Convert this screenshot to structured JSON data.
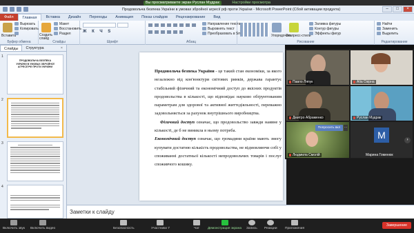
{
  "share_banner": {
    "text": "Вы просматриваете экран Руслан Мудрак",
    "options_label": "Настройки просмотра"
  },
  "ppt_title": "Продовольча безпека України в умовах збройної агресії рф проти України  -  Microsoft PowerPoint (Сбой активации продукта)",
  "menu_tabs": [
    "Файл",
    "Главная",
    "Вставка",
    "Дизайн",
    "Переходы",
    "Анимация",
    "Показ слайдов",
    "Рецензирование",
    "Вид"
  ],
  "ribbon": {
    "paste": "Вставить",
    "cut": "Вырезать",
    "copy": "Копировать",
    "format": "Формат по образцу",
    "clipboard_group": "Буфер обмена",
    "create_slide": "Создать слайд",
    "layout": "Макет",
    "reset": "Восстановить",
    "section": "Раздел",
    "slides_group": "Слайды",
    "font_group": "Шрифт",
    "paragraph_group": "Абзац",
    "text_direction": "Направление текста",
    "align_text": "Выровнять текст",
    "smartart": "Преобразовать в SmartArt",
    "drawing_group": "Рисование",
    "arrange": "Упорядочить",
    "quick_styles": "Экспресс-стили",
    "shape_fill": "Заливка фигуры",
    "shape_outline": "Контур фигуры",
    "shape_effects": "Эффекты фигур",
    "find": "Найти",
    "replace": "Заменить",
    "select": "Выделить",
    "editing_group": "Редактирование"
  },
  "panel_tabs": {
    "slides": "Слайды",
    "outline": "Структура",
    "close": "×"
  },
  "thumbs": [
    {
      "num": "1",
      "title": "ПРОДОВОЛЬЧА БЕЗПЕКА УКРАЇНИ В УМОВАХ ЗБРОЙНОЇ АГРЕСІЇ РФ ПРОТИ УКРАЇНИ"
    },
    {
      "num": "2",
      "title": ""
    },
    {
      "num": "3",
      "title": ""
    },
    {
      "num": "4",
      "title": ""
    }
  ],
  "slide": {
    "p1_bold": "Продовольча безпека України",
    "p1": " - це такий стан економіки, за якого незалежно від кон'юнктури світових ринків, держава гарантує стабільний фізичний та економічний доступ до якісних продуктів продовольства в кількості, що відповідає науково обґрунтованим параметрам для здорової та активної життєдіяльності, переважно задовольняється за рахунок внутрішнього виробництва.",
    "p2_bold": "Фізичний доступ",
    "p2": " означає, що продовольство завжди наявне у кількості,  де б не виникла в ньому потреба.",
    "p3_bold": "Економічний доступ",
    "p3": " означає, що громадяни країни мають змогу купувати достатню кількість продовольства, не відмовляючи собі у споживанні достатньої кількості непродовольчих товарів і послуг споживчого кошику."
  },
  "notes_placeholder": "Заметки к слайду",
  "participants": [
    {
      "name": "Павло Ляпук",
      "muted": true
    },
    {
      "name": "Аїіа Озірна",
      "muted": true
    },
    {
      "name": "Дмитро Абраменко",
      "muted": true
    },
    {
      "name": "Руслан Мудрак",
      "muted": true
    },
    {
      "name": "Людмила Смолій",
      "muted": true
    },
    {
      "name": "Марина Гоменюк",
      "muted": false
    }
  ],
  "ask_unmute": "Попросить вкл",
  "avatar_letter": "M",
  "zoom_toolbar": {
    "audio": "Включить звук",
    "video": "Включить видео",
    "security": "Безопасность",
    "participants": "Участники",
    "participants_count": "7",
    "chat": "Чат",
    "share": "Демонстрация экрана",
    "record": "Запись",
    "reactions": "Реакции",
    "apps": "Приложения",
    "end": "Завершение"
  },
  "colors": {
    "file_tab": "#c5402e",
    "share_green": "#27c33e",
    "end_red": "#d9332a",
    "thumb_selected": "#f2b94a"
  }
}
